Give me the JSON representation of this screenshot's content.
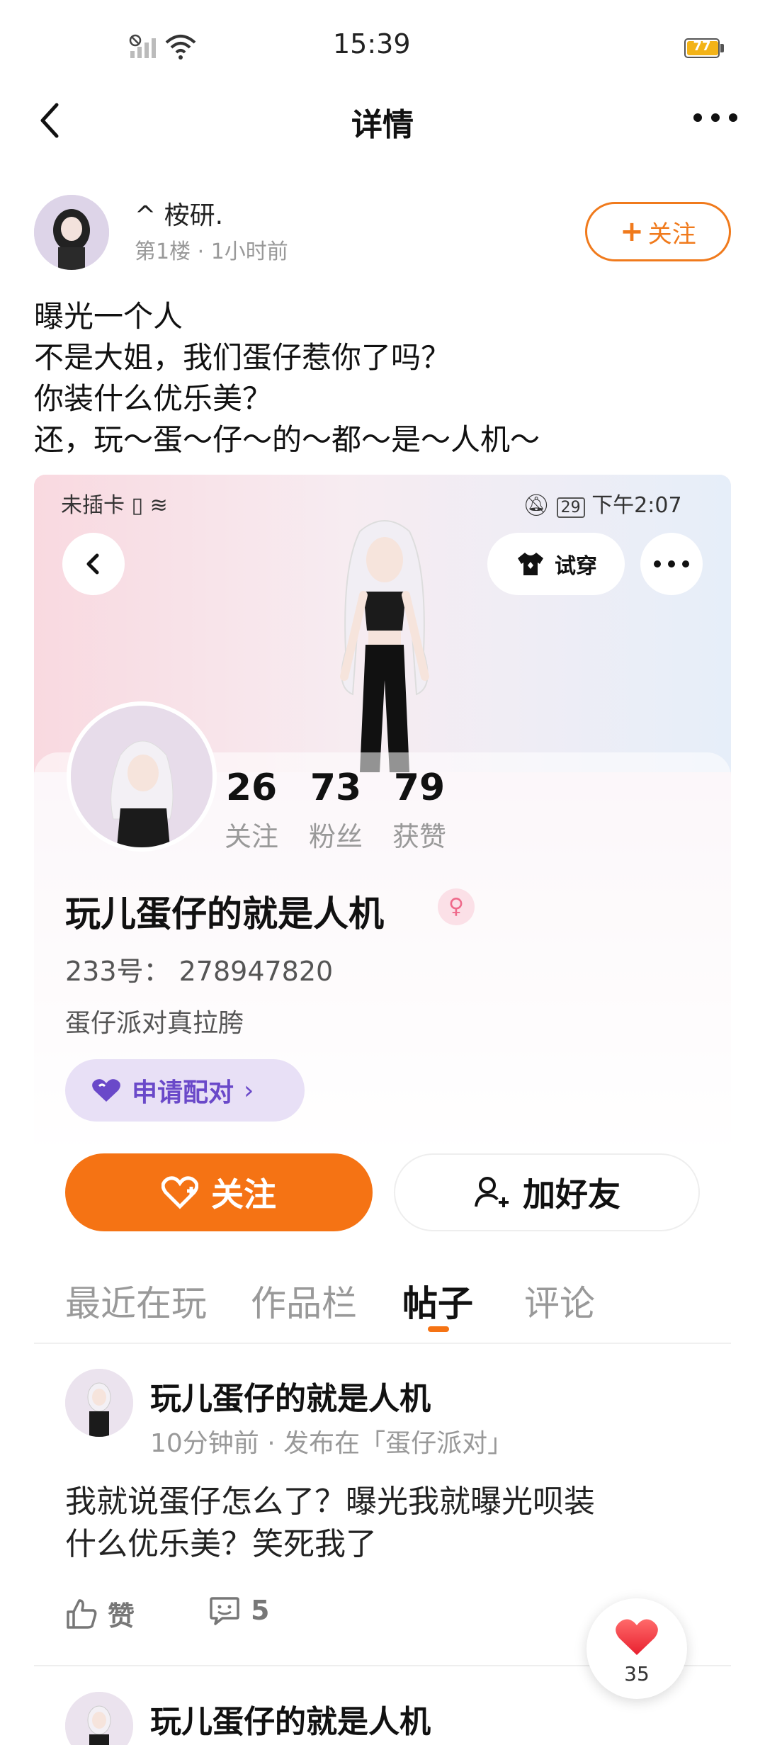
{
  "status_bar": {
    "time": "15:39",
    "battery": "77"
  },
  "nav": {
    "title": "详情"
  },
  "author": {
    "name": "^ 桉研.",
    "meta": "第1楼 · 1小时前",
    "follow_label": "关注"
  },
  "post": {
    "lines": [
      "曝光一个人",
      "不是大姐，我们蛋仔惹你了吗？",
      "你装什么优乐美？",
      "还，玩～蛋～仔～的～都～是～人机～"
    ]
  },
  "screenshot": {
    "status_left": "未插卡",
    "status_battery": "29",
    "status_time": "下午2:07",
    "try_on_label": "试穿",
    "stats": [
      {
        "value": "26",
        "label": "关注"
      },
      {
        "value": "73",
        "label": "粉丝"
      },
      {
        "value": "79",
        "label": "获赞"
      }
    ],
    "profile_name": "玩儿蛋仔的就是人机",
    "profile_id": "233号： 278947820",
    "signature": "蛋仔派对真拉胯",
    "pair_label": "申请配对",
    "follow_label": "关注",
    "add_friend_label": "加好友",
    "tabs": [
      "最近在玩",
      "作品栏",
      "帖子",
      "评论"
    ],
    "active_tab": "帖子",
    "feed": [
      {
        "name": "玩儿蛋仔的就是人机",
        "meta": "10分钟前 · 发布在「蛋仔派对」",
        "text_lines": [
          "我就说蛋仔怎么了？曝光我就曝光呗装",
          "什么优乐美？笑死我了"
        ],
        "like_label": "赞",
        "comment_count": "5"
      },
      {
        "name": "玩儿蛋仔的就是人机"
      }
    ]
  },
  "like_fab": {
    "count": "35"
  },
  "colors": {
    "accent": "#f57314",
    "pair_purple": "#6a49c9"
  }
}
